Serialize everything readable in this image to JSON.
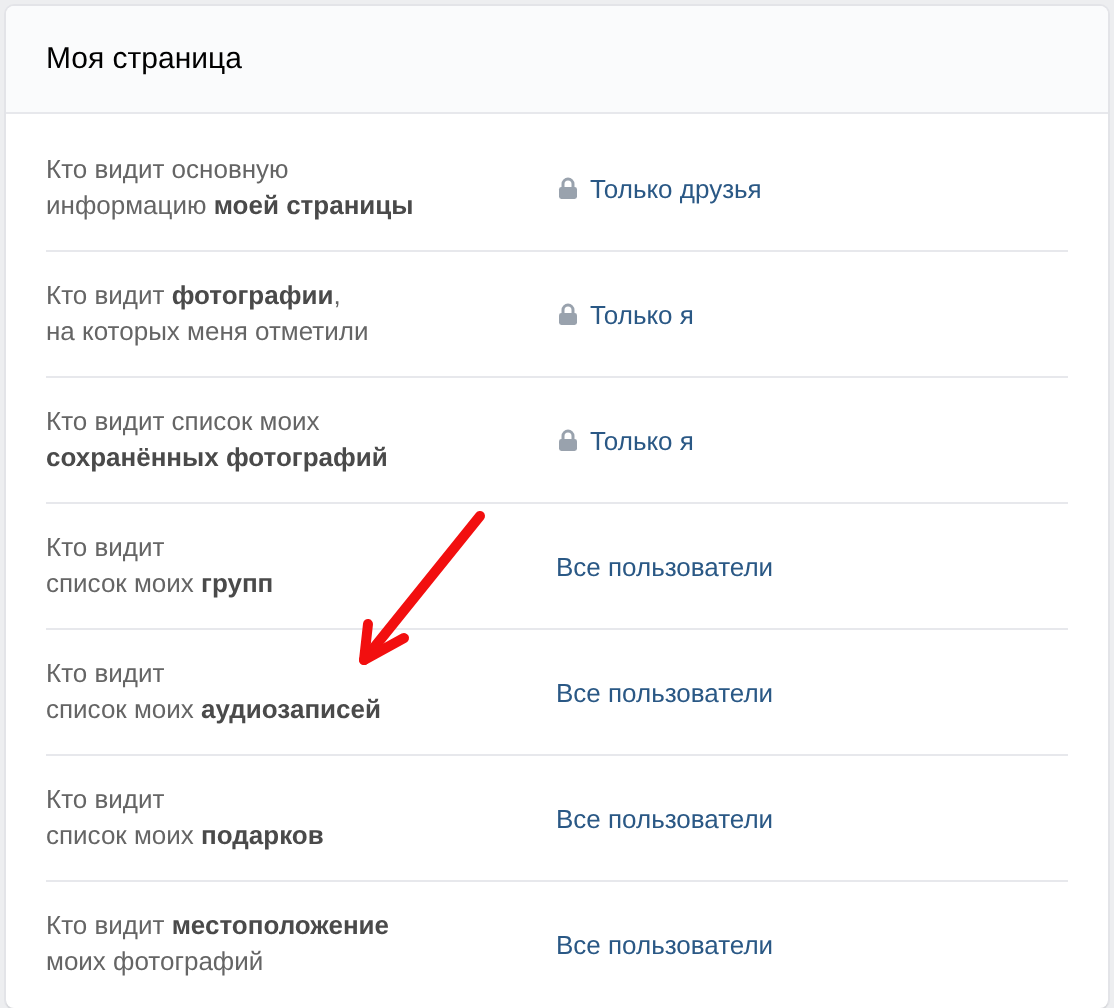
{
  "header": {
    "title": "Моя страница"
  },
  "rows": [
    {
      "label": "Кто видит основную\nинформацию **моей страницы**",
      "value": "Только друзья",
      "locked": true
    },
    {
      "label": "Кто видит **фотографии**,\nна которых меня отметили",
      "value": "Только я",
      "locked": true
    },
    {
      "label": "Кто видит список моих\n**сохранённых фотографий**",
      "value": "Только я",
      "locked": true
    },
    {
      "label": "Кто видит\nсписок моих **групп**",
      "value": "Все пользователи",
      "locked": false
    },
    {
      "label": "Кто видит\nсписок моих **аудиозаписей**",
      "value": "Все пользователи",
      "locked": false
    },
    {
      "label": "Кто видит\nсписок моих **подарков**",
      "value": "Все пользователи",
      "locked": false
    },
    {
      "label": "Кто видит **местоположение**\nмоих фотографий",
      "value": "Все пользователи",
      "locked": false
    }
  ],
  "annotations": [
    {
      "kind": "arrow"
    }
  ]
}
